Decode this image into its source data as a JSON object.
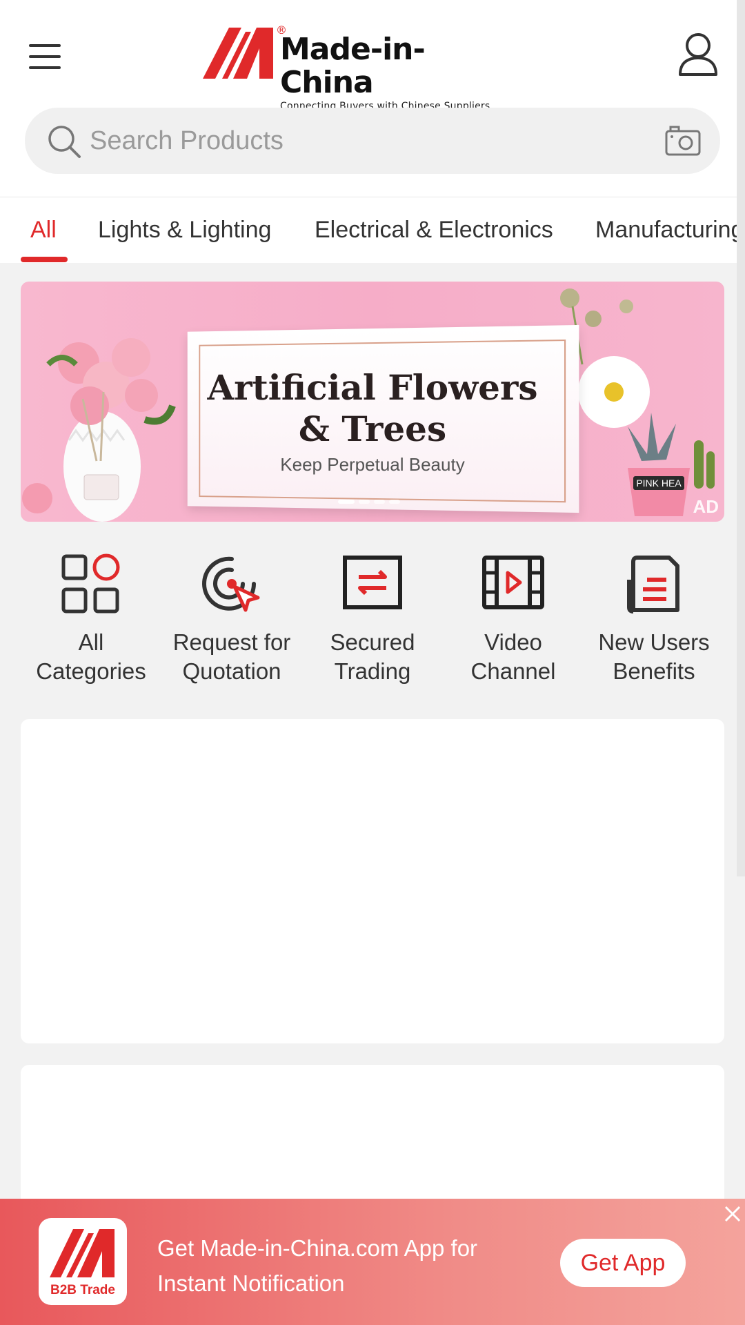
{
  "header": {
    "logo_name": "Made-in-China",
    "logo_tagline": "Connecting Buyers with Chinese Suppliers",
    "logo_reg": "®"
  },
  "search": {
    "placeholder": "Search Products"
  },
  "tabs": [
    {
      "label": "All",
      "active": true
    },
    {
      "label": "Lights & Lighting"
    },
    {
      "label": "Electrical & Electronics"
    },
    {
      "label": "Manufacturing"
    }
  ],
  "banner": {
    "title_line1": "Artificial  Flowers",
    "title_line2": "& Trees",
    "subtitle": "Keep Perpetual Beauty",
    "ad_label": "AD",
    "pot_label": "PINK HEA"
  },
  "quick_links": [
    {
      "line1": "All",
      "line2": "Categories",
      "icon": "all-categories-icon"
    },
    {
      "line1": "Request for",
      "line2": "Quotation",
      "icon": "target-icon"
    },
    {
      "line1": "Secured",
      "line2": "Trading",
      "icon": "exchange-icon"
    },
    {
      "line1": "Video",
      "line2": "Channel",
      "icon": "video-icon"
    },
    {
      "line1": "New Users",
      "line2": "Benefits",
      "icon": "document-icon"
    }
  ],
  "app_banner": {
    "logo_label": "B2B Trade",
    "text": "Get Made-in-China.com App for Instant Notification",
    "button": "Get App"
  },
  "colors": {
    "brand_red": "#e0292a",
    "appbar_start": "#e8585b",
    "appbar_end": "#f4a39c"
  }
}
